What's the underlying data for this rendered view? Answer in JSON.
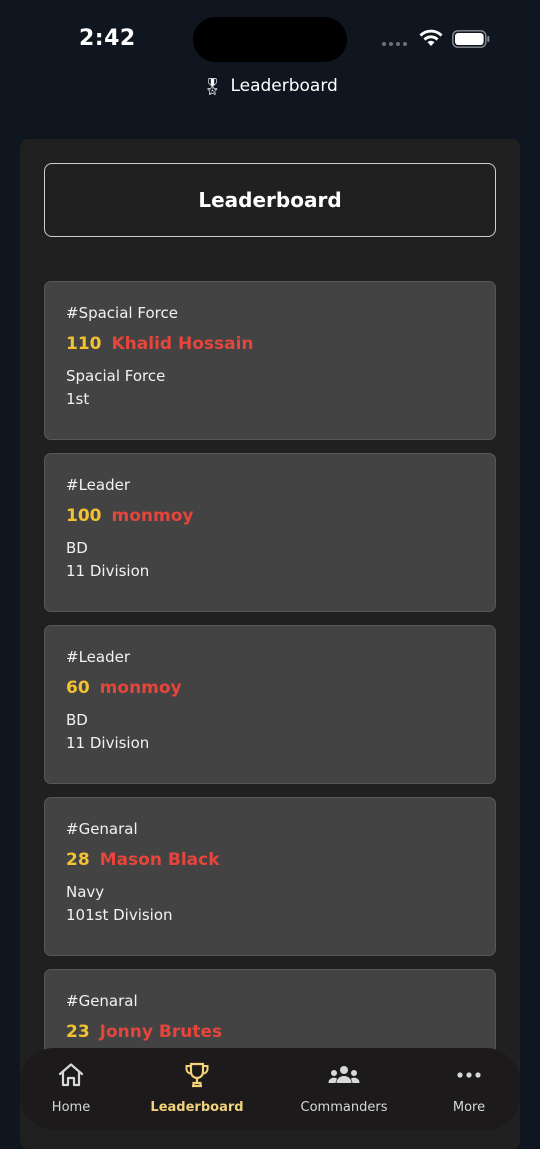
{
  "status": {
    "time": "2:42"
  },
  "nav": {
    "title": "Leaderboard",
    "title_icon": "medal-icon"
  },
  "header": {
    "label": "Leaderboard"
  },
  "entries": [
    {
      "tag": "#Spacial Force",
      "score": "110",
      "name": "Khalid Hossain",
      "line1": "Spacial Force",
      "line2": "1st"
    },
    {
      "tag": "#Leader",
      "score": "100",
      "name": "monmoy",
      "line1": "BD",
      "line2": "11 Division"
    },
    {
      "tag": "#Leader",
      "score": "60",
      "name": "monmoy",
      "line1": "BD",
      "line2": "11 Division"
    },
    {
      "tag": "#Genaral",
      "score": "28",
      "name": "Mason Black",
      "line1": "Navy",
      "line2": "101st Division"
    },
    {
      "tag": "#Genaral",
      "score": "23",
      "name": "Jonny Brutes",
      "line1": "",
      "line2": ""
    }
  ],
  "tabs": [
    {
      "label": "Home",
      "icon": "home-icon",
      "active": false
    },
    {
      "label": "Leaderboard",
      "icon": "trophy-icon",
      "active": true
    },
    {
      "label": "Commanders",
      "icon": "group-icon",
      "active": false
    },
    {
      "label": "More",
      "icon": "more-icon",
      "active": false
    }
  ],
  "colors": {
    "background": "#0f1620",
    "panel": "#202020",
    "card": "#434343",
    "score": "#f3c230",
    "name": "#e5453a",
    "active_tab": "#f1d27a"
  }
}
